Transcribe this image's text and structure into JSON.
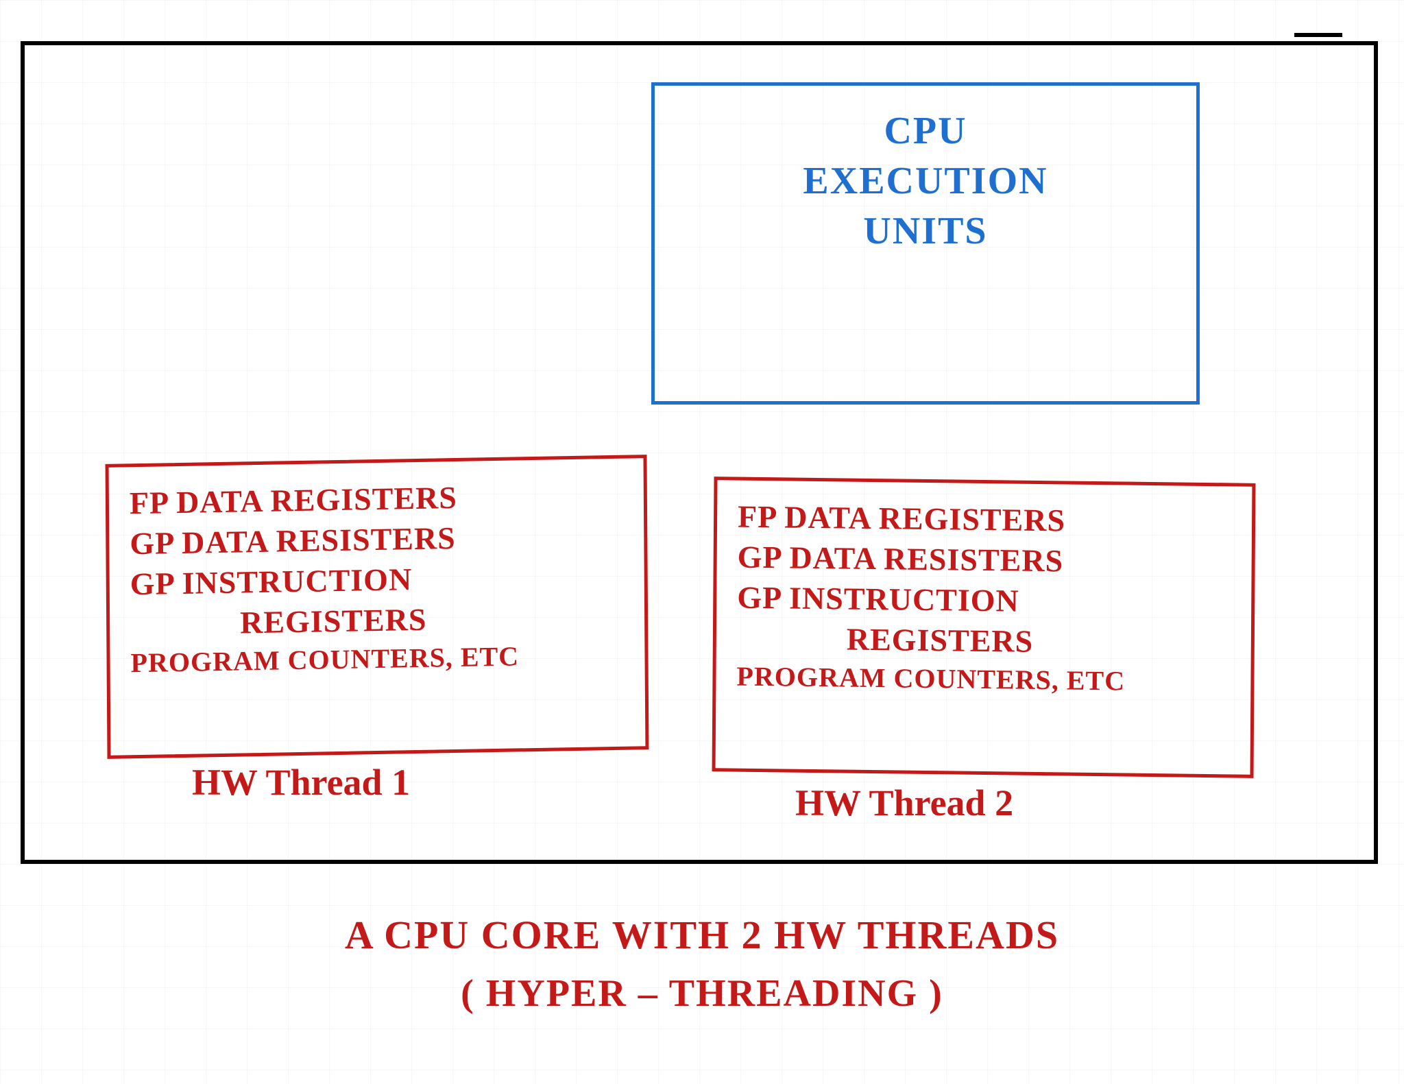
{
  "colors": {
    "outer_border": "#000000",
    "exec_box": "#1f6fd1",
    "thread_box": "#c31919",
    "caption": "#c31919"
  },
  "exec": {
    "line1": "CPU",
    "line2": "EXECUTION",
    "line3": "UNITS"
  },
  "thread1": {
    "row1": "FP DATA REGISTERS",
    "row2": "GP DATA RESISTERS",
    "row3": "GP INSTRUCTION",
    "row3b": "REGISTERS",
    "row4": "PROGRAM COUNTERS, etc",
    "label": "HW Thread 1"
  },
  "thread2": {
    "row1": "FP DATA REGISTERS",
    "row2": "GP DATA RESISTERS",
    "row3": "GP INSTRUCTION",
    "row3b": "REGISTERS",
    "row4": "PROGRAM COUNTERS, etc",
    "label": "HW Thread 2"
  },
  "caption": {
    "line1": "A CPU CORE WITH 2 HW THREADS",
    "line2": "( HYPER – THREADING )"
  }
}
